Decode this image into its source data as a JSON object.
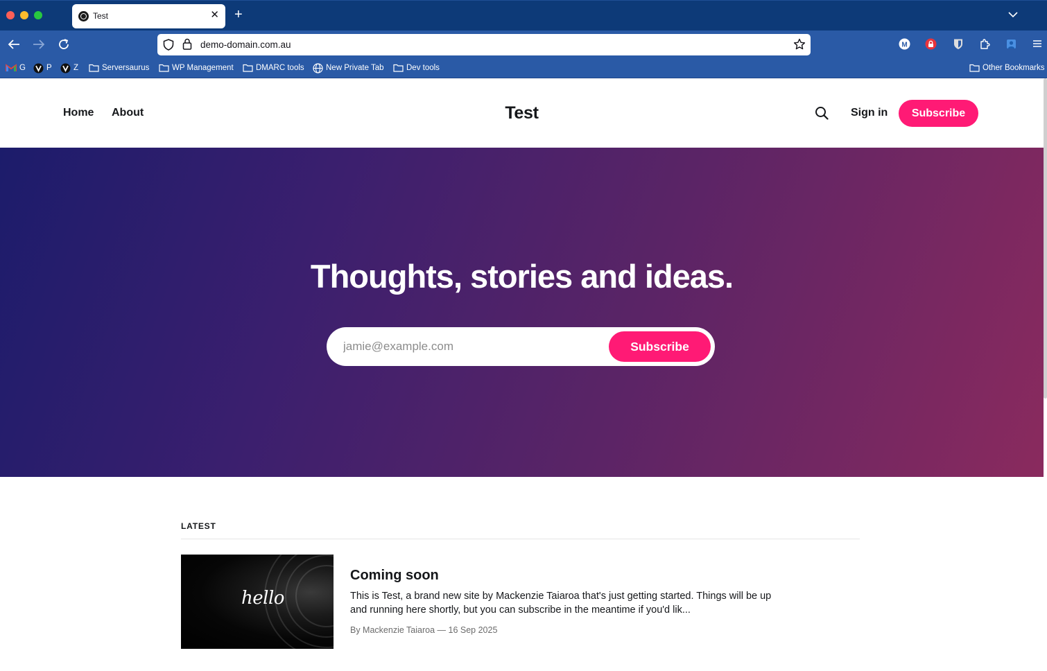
{
  "browser": {
    "tab_title": "Test",
    "url": "demo-domain.com.au",
    "bookmarks": [
      {
        "label": "G",
        "icon": "gmail-icon"
      },
      {
        "label": "P",
        "icon": "vultr-icon"
      },
      {
        "label": "Z",
        "icon": "vultr-icon"
      },
      {
        "label": "Serversaurus",
        "icon": "folder-icon"
      },
      {
        "label": "WP Management",
        "icon": "folder-icon"
      },
      {
        "label": "DMARC tools",
        "icon": "folder-icon"
      },
      {
        "label": "New Private Tab",
        "icon": "globe-icon"
      },
      {
        "label": "Dev tools",
        "icon": "folder-icon"
      }
    ],
    "other_bookmarks": "Other Bookmarks",
    "colors": {
      "titlebar": "#0d3a78",
      "toolbar": "#2a5aa6"
    }
  },
  "site": {
    "nav": {
      "home": "Home",
      "about": "About"
    },
    "title": "Test",
    "sign_in": "Sign in",
    "subscribe": "Subscribe",
    "accent": "#ff1a75"
  },
  "hero": {
    "title": "Thoughts, stories and ideas.",
    "email_placeholder": "jamie@example.com",
    "subscribe": "Subscribe"
  },
  "latest": {
    "label": "LATEST",
    "posts": [
      {
        "image_text": "hello",
        "title": "Coming soon",
        "excerpt": "This is Test, a brand new site by Mackenzie Taiaroa that's just getting started. Things will be up and running here shortly, but you can subscribe in the meantime if you'd lik...",
        "meta": "By Mackenzie Taiaroa — 16 Sep 2025"
      }
    ]
  }
}
